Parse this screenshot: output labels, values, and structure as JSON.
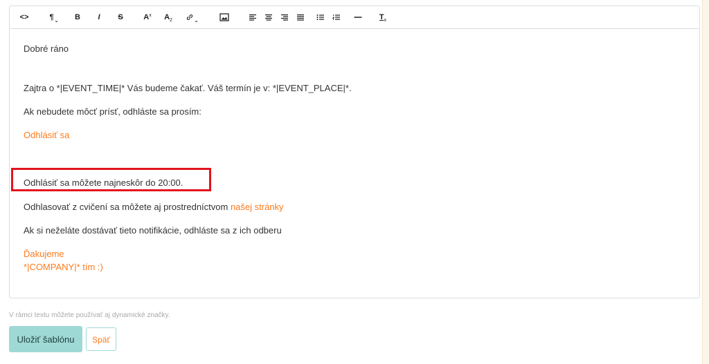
{
  "toolbar": {
    "source": "<>",
    "paragraph": "¶",
    "bold": "B",
    "italic": "I",
    "strike": "S",
    "superscript_base": "A",
    "superscript_mark": "x",
    "subscript_base": "A",
    "subscript_mark": "2",
    "link": "🔗",
    "clear_format": "T"
  },
  "editor": {
    "line1": "Dobré ráno",
    "line2": "Zajtra o *|EVENT_TIME|* Vás budeme čakať. Váš termín je v: *|EVENT_PLACE|*.",
    "line3": "Ak nebudete môcť prísť, odhláste sa prosím:",
    "unsubscribe_link": "Odhlásiť sa",
    "deadline_text": "Odhlásiť sa môžete najneskôr do 20:00.",
    "line_website_prefix": "Odhlasovať z cvičení sa môžete aj prostredníctvom ",
    "line_website_link": "našej stránky",
    "line_notifications": "Ak si neželáte dostávať tieto notifikácie, odhláste sa z ich odberu",
    "thanks": "Ďakujeme",
    "signature": "*|COMPANY|* tím :)"
  },
  "hint": "V rámci textu môžete používať aj dynamické značky.",
  "buttons": {
    "save": "Uložiť šablónu",
    "back": "Späť"
  },
  "colors": {
    "accent_orange": "#ff7a1c",
    "button_teal": "#9fd9d6",
    "highlight_red": "#e2141d"
  }
}
